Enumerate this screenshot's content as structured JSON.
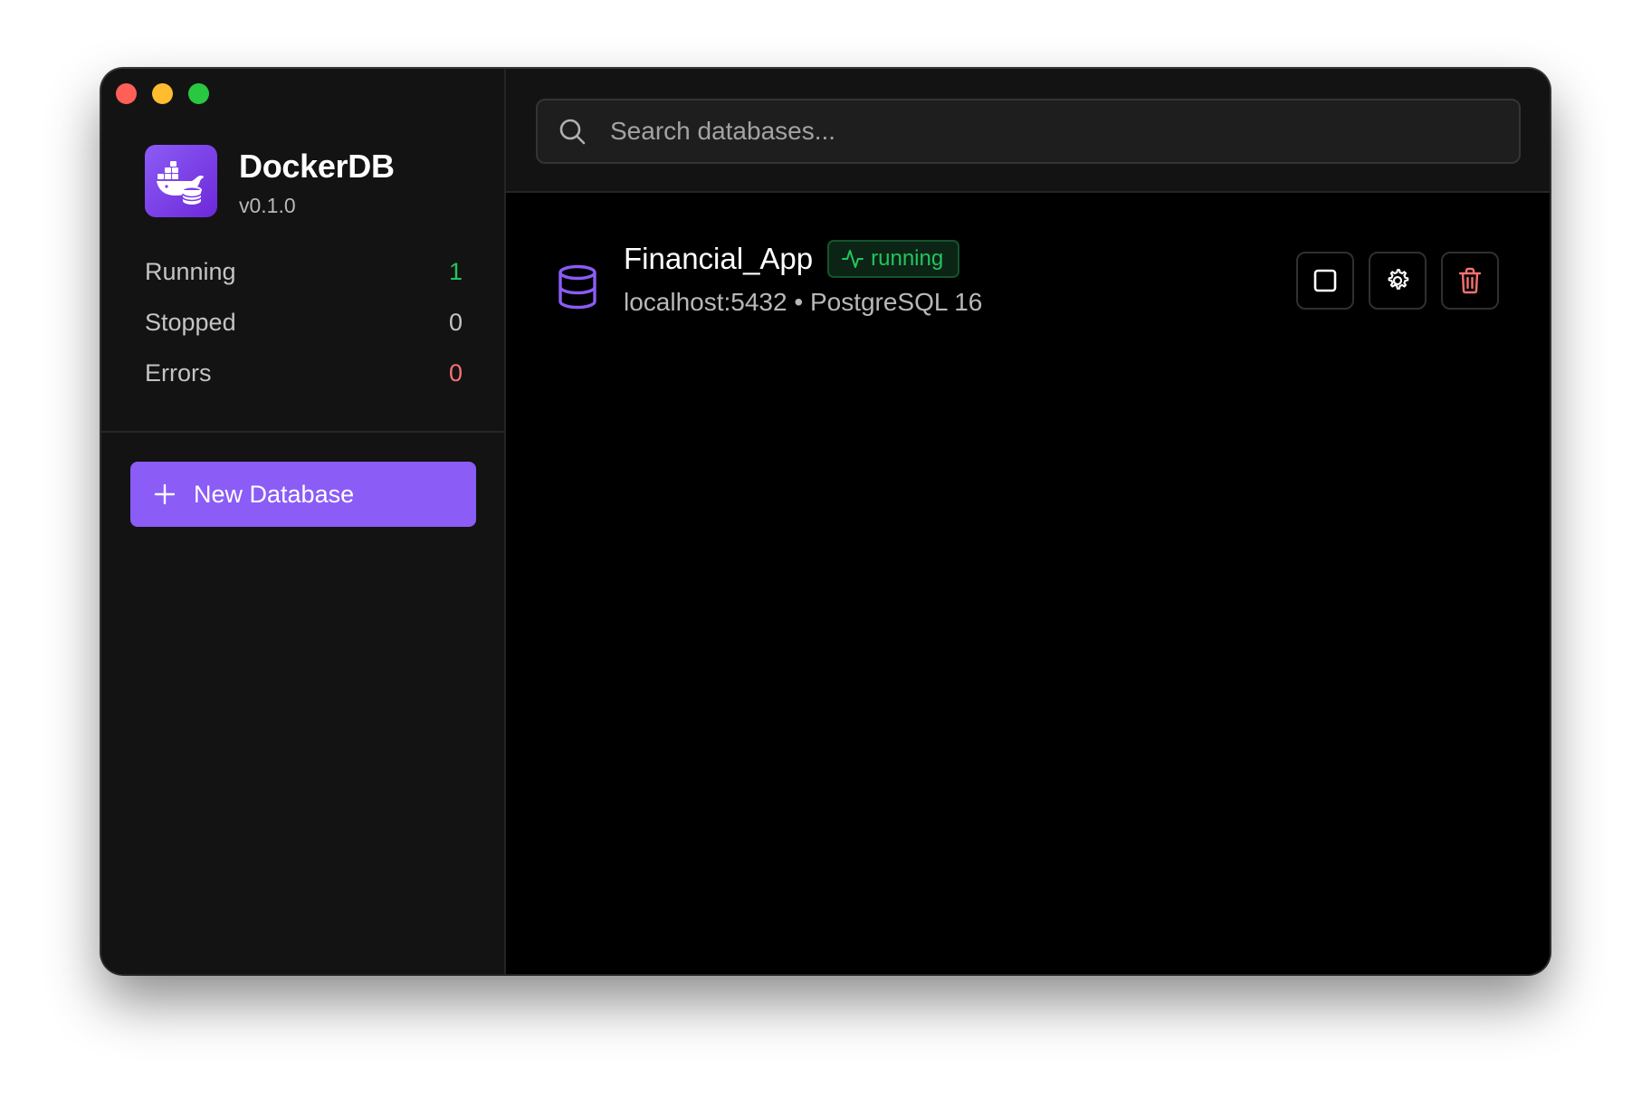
{
  "app": {
    "name": "DockerDB",
    "version": "v0.1.0"
  },
  "stats": [
    {
      "label": "Running",
      "value": "1",
      "color": "#22c55e"
    },
    {
      "label": "Stopped",
      "value": "0",
      "color": "#c4c4c4"
    },
    {
      "label": "Errors",
      "value": "0",
      "color": "#f87171"
    }
  ],
  "sidebar": {
    "new_database_label": "New Database"
  },
  "search": {
    "placeholder": "Search databases...",
    "value": ""
  },
  "databases": [
    {
      "name": "Financial_App",
      "status": "running",
      "meta": "localhost:5432 • PostgreSQL 16",
      "icon": "database-icon"
    }
  ],
  "icons": {
    "search": "search-icon",
    "plus": "plus-icon",
    "stop": "stop-icon",
    "settings": "gear-icon",
    "delete": "trash-icon",
    "status": "activity-icon"
  },
  "colors": {
    "accent": "#8b5cf6",
    "running": "#22c55e",
    "error": "#f87171",
    "sidebar_bg": "#131313",
    "main_bg": "#000000"
  }
}
